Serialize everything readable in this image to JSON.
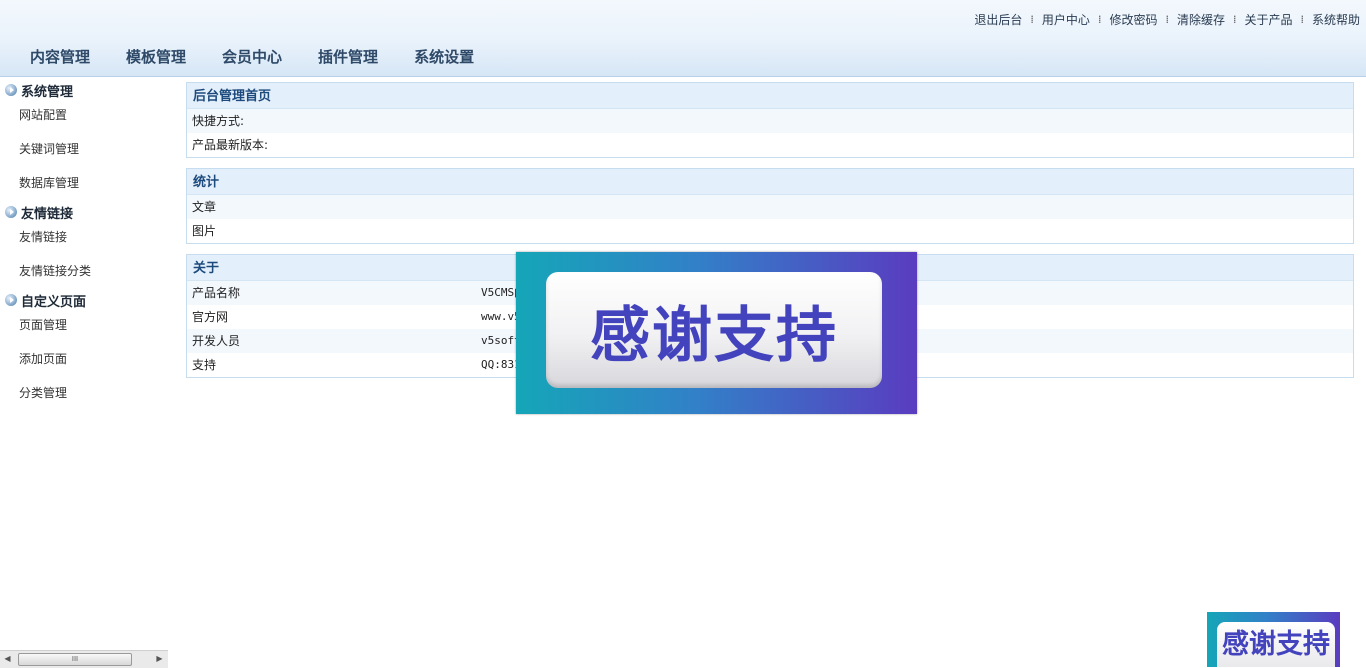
{
  "header": {
    "top_links": [
      "退出后台",
      "用户中心",
      "修改密码",
      "清除缓存",
      "关于产品",
      "系统帮助"
    ],
    "tabs": [
      "内容管理",
      "模板管理",
      "会员中心",
      "插件管理",
      "系统设置"
    ]
  },
  "sidebar": {
    "groups": [
      {
        "title": "系统管理",
        "items": [
          "网站配置",
          "关键词管理",
          "数据库管理"
        ]
      },
      {
        "title": "友情链接",
        "items": [
          "友情链接",
          "友情链接分类"
        ]
      },
      {
        "title": "自定义页面",
        "items": [
          "页面管理",
          "添加页面",
          "分类管理"
        ]
      }
    ],
    "scrollbar_grip": "III"
  },
  "panels": {
    "home": {
      "title": "后台管理首页",
      "rows": [
        "快捷方式:",
        "产品最新版本:"
      ]
    },
    "stats": {
      "title": "统计",
      "rows": [
        "文章",
        "图片"
      ]
    },
    "about": {
      "title": "关于",
      "rows": [
        {
          "label": "产品名称",
          "value": "V5CMS内"
        },
        {
          "label": "官方网",
          "value": "www.v5"
        },
        {
          "label": "开发人员",
          "value": "v5soft"
        },
        {
          "label": "支持",
          "value": "QQ:831"
        }
      ]
    }
  },
  "overlay": {
    "banner_text": "感谢支持",
    "small_banner_text": "感谢支持"
  },
  "colors": {
    "header_bg": "#e9f2fb",
    "panel_title_bg": "#e3effa",
    "banner_text": "#4343bd"
  }
}
